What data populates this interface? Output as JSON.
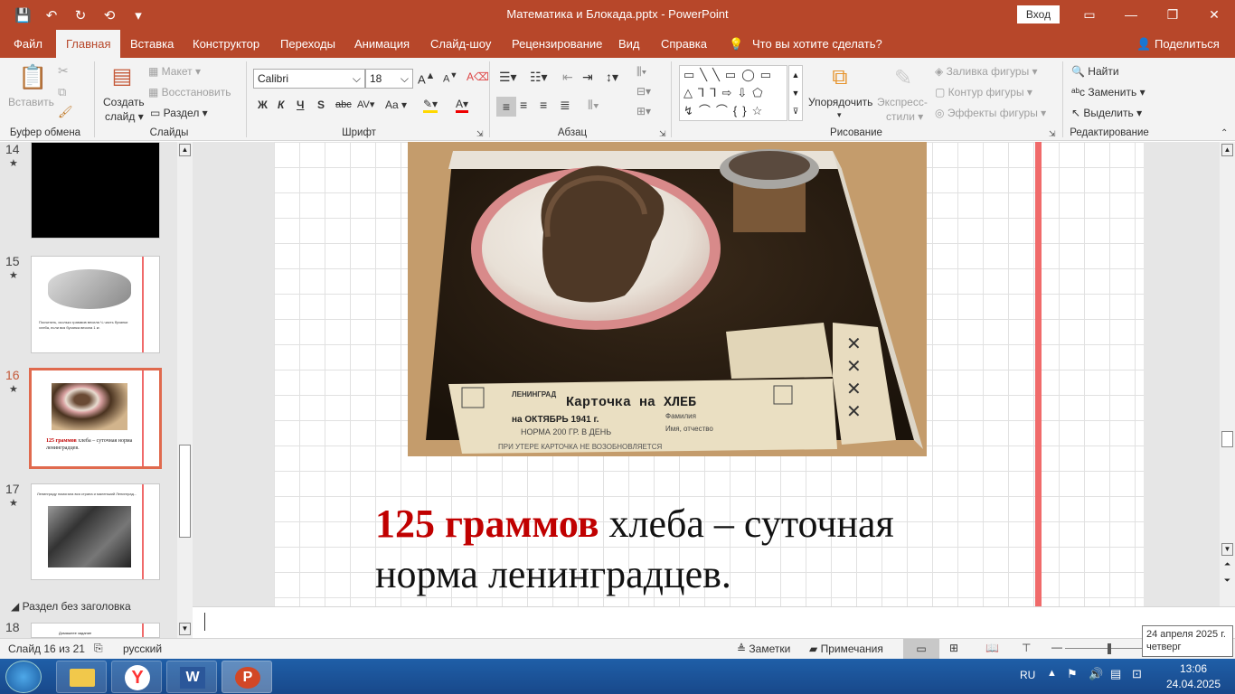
{
  "titlebar": {
    "doc_title": "Математика и Блокада.pptx  -  PowerPoint",
    "signin": "Вход",
    "qat": [
      "💾",
      "↶",
      "↻",
      "⟲",
      "▾"
    ]
  },
  "tabs": [
    "Файл",
    "Главная",
    "Вставка",
    "Конструктор",
    "Переходы",
    "Анимация",
    "Слайд-шоу",
    "Рецензирование",
    "Вид",
    "Справка",
    "Что вы хотите сделать?",
    "Поделиться"
  ],
  "ribbon": {
    "clipboard": {
      "paste": "Вставить",
      "label": "Буфер обмена"
    },
    "slides": {
      "new_slide": "Создать",
      "new_slide2": "слайд",
      "layout": "Макет",
      "reset": "Восстановить",
      "section": "Раздел",
      "label": "Слайды"
    },
    "font": {
      "name": "Calibri",
      "size": "18",
      "bold": "Ж",
      "italic": "К",
      "underline": "Ч",
      "shadow": "S",
      "strike": "abc",
      "spacing": "AV",
      "case": "Aa",
      "label": "Шрифт"
    },
    "paragraph": {
      "label": "Абзац"
    },
    "drawing": {
      "arrange": "Упорядочить",
      "quick_styles": "Экспресс-",
      "quick_styles2": "стили",
      "fill": "Заливка фигуры",
      "outline": "Контур фигуры",
      "effects": "Эффекты фигуры",
      "label": "Рисование"
    },
    "editing": {
      "find": "Найти",
      "replace": "Заменить",
      "select": "Выделить",
      "label": "Редактирование"
    }
  },
  "thumbs": [
    {
      "num": "14",
      "star": "★"
    },
    {
      "num": "15",
      "star": "★",
      "text": "Посчитать, сколько граммов весила ¼ часть буханки хлеба, если вся буханка весила 1 кг."
    },
    {
      "num": "16",
      "star": "★",
      "text_hl": "125 граммов",
      "text": " хлеба – суточная норма ленинградцев."
    },
    {
      "num": "17",
      "star": "★",
      "text": "Ленинграду помогала вся страна и маленький Ленинград..."
    }
  ],
  "section": {
    "label": "Раздел без заголовка",
    "num": "18",
    "thumb_text": "Домашнее задание"
  },
  "slide": {
    "highlight": "125 граммов",
    "text1": " хлеба – суточная",
    "text2": "норма ленинградцев.",
    "card_title": "Карточка на ХЛЕБ",
    "card_city": "ЛЕНИНГРАД",
    "card_month": "на ОКТЯБРЬ 1941 г.",
    "card_norm": "НОРМА 200 ГР. В ДЕНЬ",
    "card_field1": "Фамилия",
    "card_field2": "Имя, отчество",
    "card_footer": "ПРИ УТЕРЕ КАРТОЧКА НЕ ВОЗОБНОВЛЯЕТСЯ"
  },
  "status": {
    "slide": "Слайд 16 из 21",
    "lang": "русский",
    "notes": "Заметки",
    "comments": "Примечания"
  },
  "taskbar": {
    "lang": "RU",
    "time": "13:06",
    "date": "24.04.2025"
  },
  "tooltip": {
    "line1": "24 апреля 2025 г.",
    "line2": "четверг"
  }
}
